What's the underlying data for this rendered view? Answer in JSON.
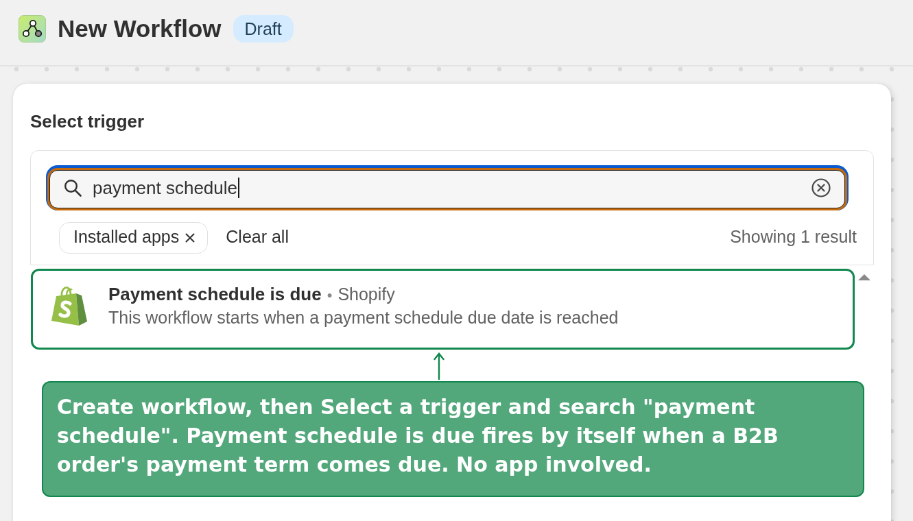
{
  "header": {
    "title": "New Workflow",
    "badge": "Draft"
  },
  "trigger_panel": {
    "title": "Select trigger",
    "search": {
      "value": "payment schedule",
      "focused": true,
      "highlighted": true
    },
    "filters": [
      {
        "label": "Installed apps"
      }
    ],
    "clear_all": "Clear all",
    "result_count": "Showing 1 result",
    "results": [
      {
        "title": "Payment schedule is due",
        "separator": "•",
        "source": "Shopify",
        "description": "This workflow starts when a payment schedule due date is reached",
        "highlighted": true
      }
    ]
  },
  "annotation": {
    "text": "Create workflow, then Select a trigger and search \"payment schedule\". Payment schedule is due fires by itself when a B2B order's payment term comes due. No app involved."
  }
}
